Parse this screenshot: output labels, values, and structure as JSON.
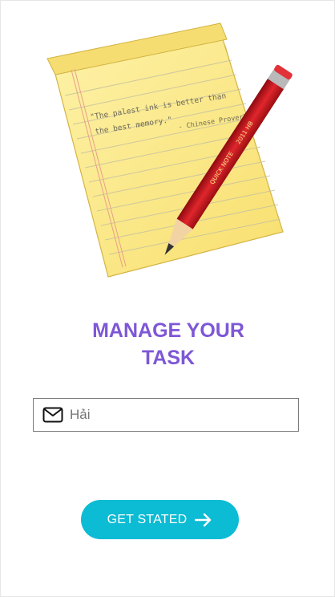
{
  "colors": {
    "accent": "#7e57d6",
    "button": "#0cbbd4",
    "button_text": "#ffffff",
    "border": "#7a7a7a",
    "paper": "#fbe98a",
    "pencil": "#c8141c"
  },
  "hero": {
    "quote_line1": "\"The palest ink is better than",
    "quote_line2": "the best memory.\"",
    "quote_author": "- Chinese Proverb",
    "pencil_text": "QUICK NOTE",
    "pencil_text2": "2011 HB"
  },
  "title": {
    "line1": "MANAGE YOUR",
    "line2": "TASK"
  },
  "name_field": {
    "value": "",
    "placeholder": "Hải",
    "icon": "mail-icon"
  },
  "start_button": {
    "label": "GET STATED",
    "icon": "arrow-right-icon"
  }
}
